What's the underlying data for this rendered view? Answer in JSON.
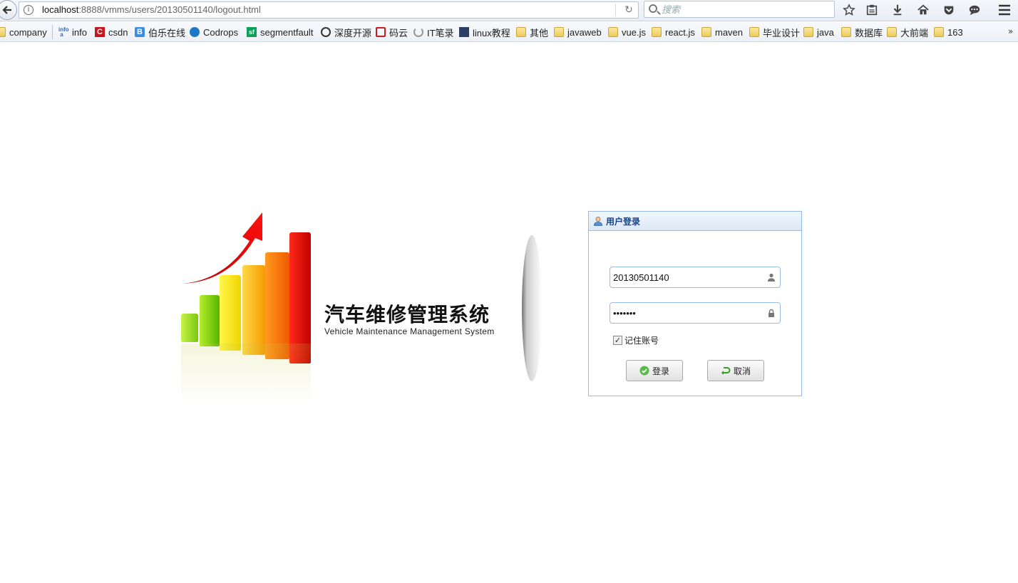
{
  "browser": {
    "url_host": "localhost",
    "url_rest": ":8888/vmms/users/20130501140/logout.html",
    "search_placeholder": "搜索"
  },
  "bookmarks": [
    {
      "label": "company",
      "icon": "folder-icon"
    },
    {
      "label": "info",
      "icon": "info-site-icon"
    },
    {
      "label": "csdn",
      "icon": "csdn-icon"
    },
    {
      "label": "伯乐在线",
      "icon": "jobbole-icon"
    },
    {
      "label": "Codrops",
      "icon": "codrops-icon"
    },
    {
      "label": "segmentfault",
      "icon": "segmentfault-icon"
    },
    {
      "label": "深度开源",
      "icon": "open-source-icon"
    },
    {
      "label": "码云",
      "icon": "gitee-icon"
    },
    {
      "label": "IT笔录",
      "icon": "loading-icon"
    },
    {
      "label": "linux教程",
      "icon": "linux-icon"
    },
    {
      "label": "其他",
      "icon": "folder-icon"
    },
    {
      "label": "javaweb",
      "icon": "folder-icon"
    },
    {
      "label": "vue.js",
      "icon": "folder-icon"
    },
    {
      "label": "react.js",
      "icon": "folder-icon"
    },
    {
      "label": "maven",
      "icon": "folder-icon"
    },
    {
      "label": "毕业设计",
      "icon": "folder-icon"
    },
    {
      "label": "java",
      "icon": "folder-icon"
    },
    {
      "label": "数据库",
      "icon": "folder-icon"
    },
    {
      "label": "大前端",
      "icon": "folder-icon"
    },
    {
      "label": "163",
      "icon": "folder-icon"
    }
  ],
  "bookmarks_more": "»",
  "app": {
    "title": "汽车维修管理系统",
    "subtitle": "Vehicle Maintenance Management System"
  },
  "login": {
    "panel_title": "用户登录",
    "username_value": "20130501140",
    "password_value": "1234567",
    "remember_label": "记住账号",
    "remember_checked": "✓",
    "login_label": "登录",
    "cancel_label": "取消"
  },
  "colors": {
    "panel_border": "#99bbe8",
    "panel_title": "#15428b"
  }
}
